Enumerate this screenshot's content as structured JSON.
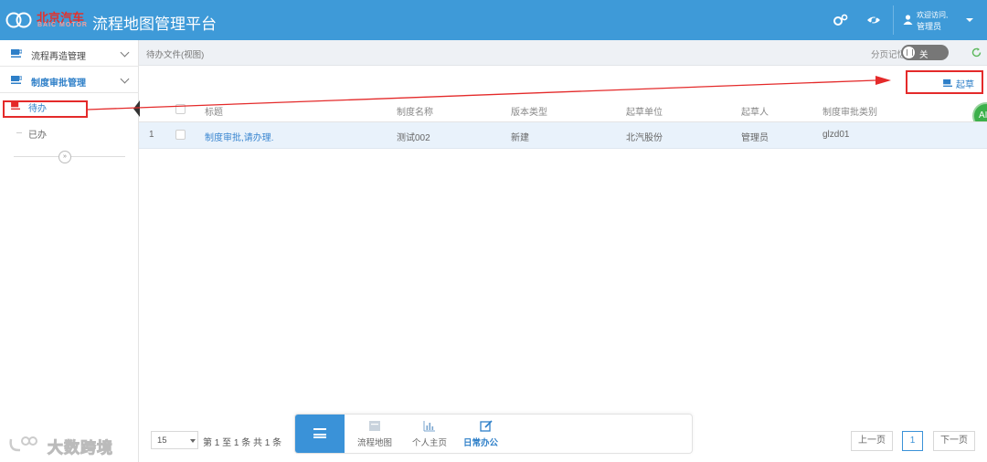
{
  "header": {
    "brand_cn": "北京汽车",
    "brand_en": "BAIC MOTOR",
    "app_title": "流程地图管理平台",
    "welcome": "欢迎访问,",
    "username": "管理员",
    "icons": [
      "settings-icon",
      "eye-icon",
      "user-icon"
    ]
  },
  "sidebar": {
    "groups": [
      {
        "label": "流程再造管理",
        "expanded": false
      },
      {
        "label": "制度审批管理",
        "expanded": true
      }
    ],
    "subitems": [
      {
        "label": "待办",
        "selected": true
      },
      {
        "label": "已办",
        "selected": false
      }
    ],
    "collapse_glyph": "»"
  },
  "breadcrumb": {
    "path": "待办文件(视图)",
    "page_memory_label": "分页记忆",
    "toggle_label": "关"
  },
  "toolbar": {
    "draft_label": "起草",
    "badge_text": "AI"
  },
  "table": {
    "columns": [
      "标题",
      "制度名称",
      "版本类型",
      "起草单位",
      "起草人",
      "制度审批类别"
    ],
    "rows": [
      {
        "index": "1",
        "title": "制度审批,请办理.",
        "name": "测试002",
        "version_type": "新建",
        "unit": "北汽股份",
        "drafter": "管理员",
        "category": "glzd01"
      }
    ]
  },
  "footer": {
    "page_size": "15",
    "page_info": "第 1 至 1 条 共 1 条",
    "dock_items": [
      {
        "label": "流程地图",
        "icon": "map-icon",
        "active": false
      },
      {
        "label": "个人主页",
        "icon": "chart-icon",
        "active": false
      },
      {
        "label": "日常办公",
        "icon": "edit-icon",
        "active": true
      }
    ],
    "prev_label": "上一页",
    "current_page": "1",
    "next_label": "下一页",
    "watermark": "大数跨境"
  },
  "colors": {
    "header_bg": "#3e9ad8",
    "accent": "#2e7fc8",
    "annotation_red": "#e42a2a",
    "row_highlight": "#e9f2fb"
  }
}
